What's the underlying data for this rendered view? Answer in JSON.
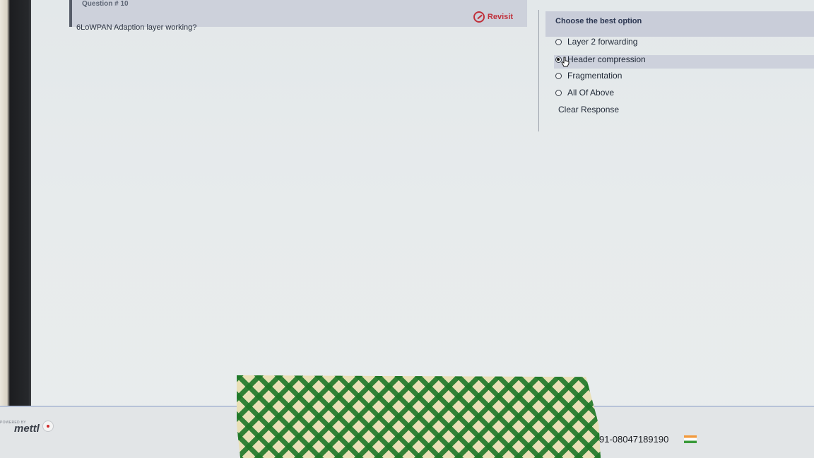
{
  "question": {
    "number_label": "Question # 10",
    "text": "6LoWPAN Adaption layer working?",
    "revisit_label": "Revisit"
  },
  "options_panel": {
    "title": "Choose the best option",
    "options": [
      {
        "label": "Layer 2 forwarding",
        "selected": false
      },
      {
        "label": "Header compression",
        "selected": true
      },
      {
        "label": "Fragmentation",
        "selected": false
      },
      {
        "label": "All Of Above",
        "selected": false
      }
    ],
    "clear_label": "Clear Response"
  },
  "footer": {
    "powered_by": "POWERED BY",
    "brand": "mettl",
    "phone": "91-08047189190"
  },
  "colors": {
    "revisit": "#c0303b",
    "header_bar": "#cdd1db",
    "flag": [
      "#f29a3e",
      "#ffffff",
      "#3a9a3a"
    ]
  }
}
